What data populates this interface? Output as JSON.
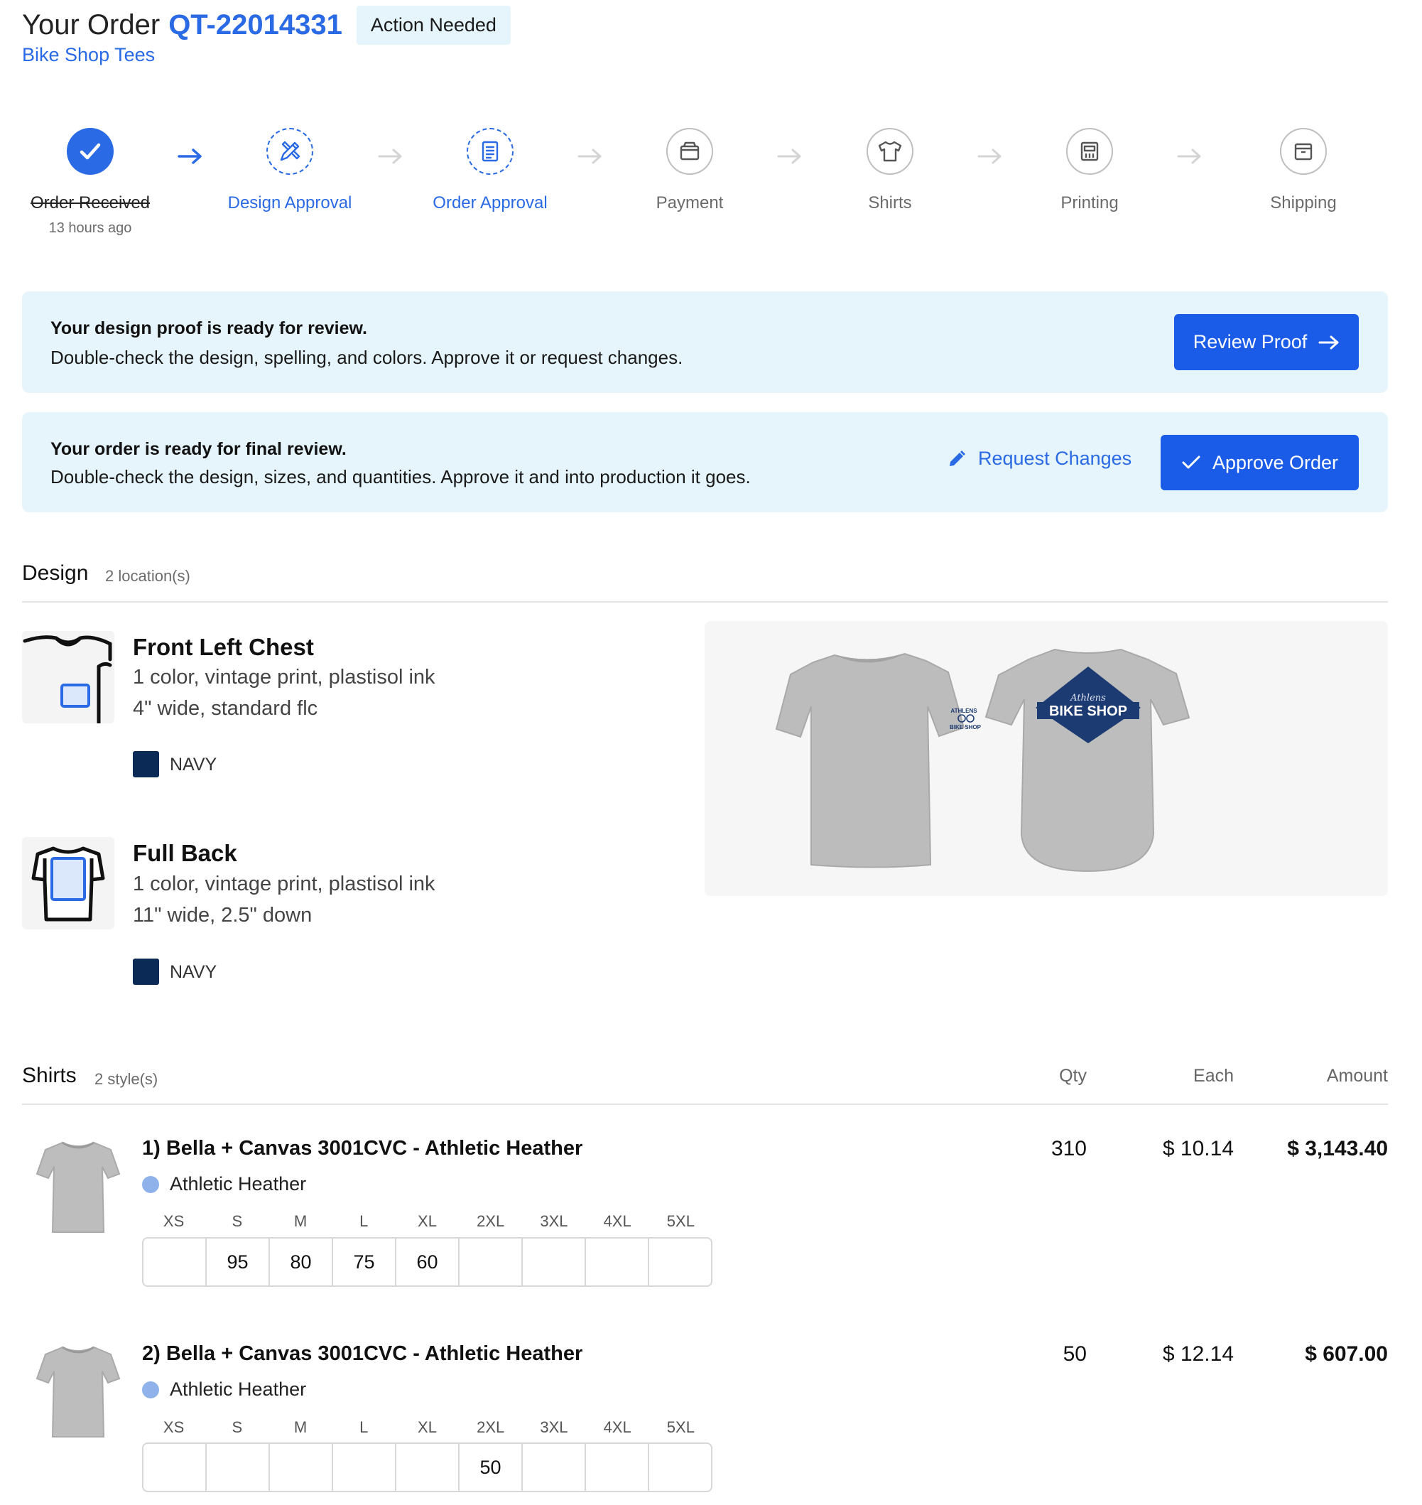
{
  "header": {
    "title": "Your Order",
    "order_number": "QT-22014331",
    "status_badge": "Action Needed",
    "shop_name": "Bike Shop Tees"
  },
  "steps": [
    {
      "label": "Order Received",
      "state": "done",
      "sub": "13 hours ago",
      "icon": "check-icon"
    },
    {
      "label": "Design Approval",
      "state": "active",
      "icon": "design-tools-icon"
    },
    {
      "label": "Order Approval",
      "state": "active",
      "icon": "document-list-icon"
    },
    {
      "label": "Payment",
      "state": "todo",
      "icon": "wallet-icon"
    },
    {
      "label": "Shirts",
      "state": "todo",
      "icon": "shirt-icon"
    },
    {
      "label": "Printing",
      "state": "todo",
      "icon": "printer-icon"
    },
    {
      "label": "Shipping",
      "state": "todo",
      "icon": "box-icon"
    }
  ],
  "banners": {
    "proof": {
      "heading": "Your design proof is ready for review.",
      "text": "Double-check the design, spelling, and colors. Approve it or request changes.",
      "button": "Review Proof"
    },
    "order": {
      "heading": "Your order is ready for final review.",
      "text": "Double-check the design, sizes, and quantities. Approve it and into production it goes.",
      "link": "Request Changes",
      "button": "Approve Order"
    }
  },
  "design": {
    "title": "Design",
    "count": "2 location(s)",
    "locations": [
      {
        "name": "Front Left Chest",
        "desc1": "1 color, vintage print, plastisol ink",
        "desc2": "4\" wide, standard flc",
        "ink_color": "NAVY"
      },
      {
        "name": "Full Back",
        "desc1": "1 color, vintage print, plastisol ink",
        "desc2": "11\" wide, 2.5\" down",
        "ink_color": "NAVY"
      }
    ],
    "mockup_text": {
      "front_small": "BIKE SHOP",
      "front_arc": "ATHLENS",
      "back_main": "BIKE SHOP",
      "back_script": "Athlens"
    }
  },
  "shirts": {
    "title": "Shirts",
    "count": "2 style(s)",
    "columns": {
      "qty": "Qty",
      "each": "Each",
      "amount": "Amount"
    },
    "sizes": [
      "XS",
      "S",
      "M",
      "L",
      "XL",
      "2XL",
      "3XL",
      "4XL",
      "5XL"
    ],
    "items": [
      {
        "name": "1) Bella + Canvas 3001CVC - Athletic Heather",
        "color": "Athletic Heather",
        "quantities": [
          "",
          "95",
          "80",
          "75",
          "60",
          "",
          "",
          "",
          ""
        ],
        "qty": "310",
        "each": "$ 10.14",
        "amount": "$ 3,143.40"
      },
      {
        "name": "2) Bella + Canvas 3001CVC - Athletic Heather",
        "color": "Athletic Heather",
        "quantities": [
          "",
          "",
          "",
          "",
          "",
          "50",
          "",
          "",
          ""
        ],
        "qty": "50",
        "each": "$ 12.14",
        "amount": "$ 607.00"
      }
    ]
  },
  "colors": {
    "accent": "#2a6ae4",
    "button": "#1a5ce8",
    "banner_bg": "#e6f5fc",
    "ink_navy": "#0b2a55",
    "heather_dot": "#8fb2ea"
  }
}
